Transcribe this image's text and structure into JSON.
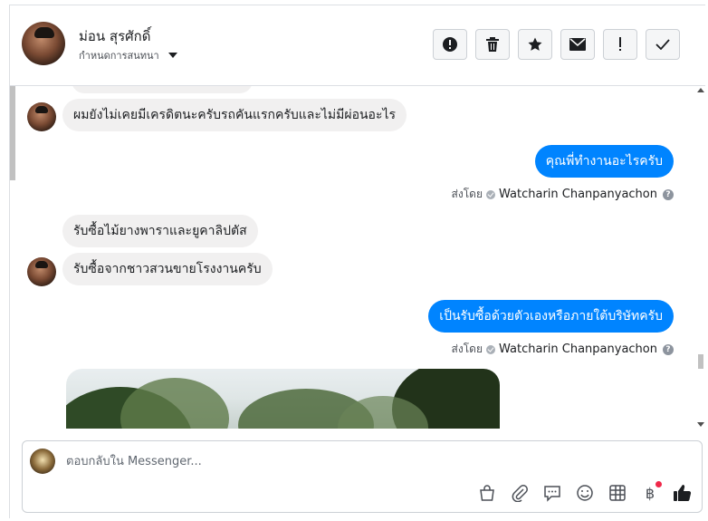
{
  "header": {
    "contact_name": "ม่อน สุรศักดิ์",
    "sub_label": "กำหนดการสนทนา",
    "toolbar": [
      {
        "icon": "alert-circle-icon",
        "name": "report-button"
      },
      {
        "icon": "trash-icon",
        "name": "delete-button"
      },
      {
        "icon": "star-icon",
        "name": "star-button"
      },
      {
        "icon": "envelope-icon",
        "name": "mark-unread-button"
      },
      {
        "icon": "exclamation-icon",
        "name": "spam-button"
      },
      {
        "icon": "checkmark-icon",
        "name": "done-button"
      }
    ]
  },
  "thread": {
    "messages": [
      {
        "direction": "in",
        "text": "ผมยังไม่เคยมีเครดิตนะครับรถคันแรกครับและไม่มีผ่อนอะไร"
      },
      {
        "direction": "out",
        "text": "คุณพี่ทำงานอะไรครับ"
      },
      {
        "direction": "in",
        "text": "รับซื้อไม้ยางพาราและยูคาลิปตัส"
      },
      {
        "direction": "in",
        "text": "รับซื้อจากชาวสวนขายโรงงานครับ"
      },
      {
        "direction": "out",
        "text": "เป็นรับซื้อด้วยตัวเองหรือภายใต้บริษัทครับ"
      }
    ],
    "sent_by_label": "ส่งโดย",
    "sent_by_name": "Watcharin Chanpanyachon"
  },
  "composer": {
    "placeholder": "ตอบกลับใน Messenger...",
    "tools": [
      "shopping-bag-icon",
      "paperclip-icon",
      "saved-reply-icon",
      "emoji-icon",
      "table-icon",
      "baht-currency-icon",
      "thumbs-up-icon"
    ],
    "currency_symbol": "฿"
  },
  "colors": {
    "outgoing_bubble": "#0084ff",
    "incoming_bubble": "#f1f0f0",
    "notification_dot": "#f02849"
  }
}
